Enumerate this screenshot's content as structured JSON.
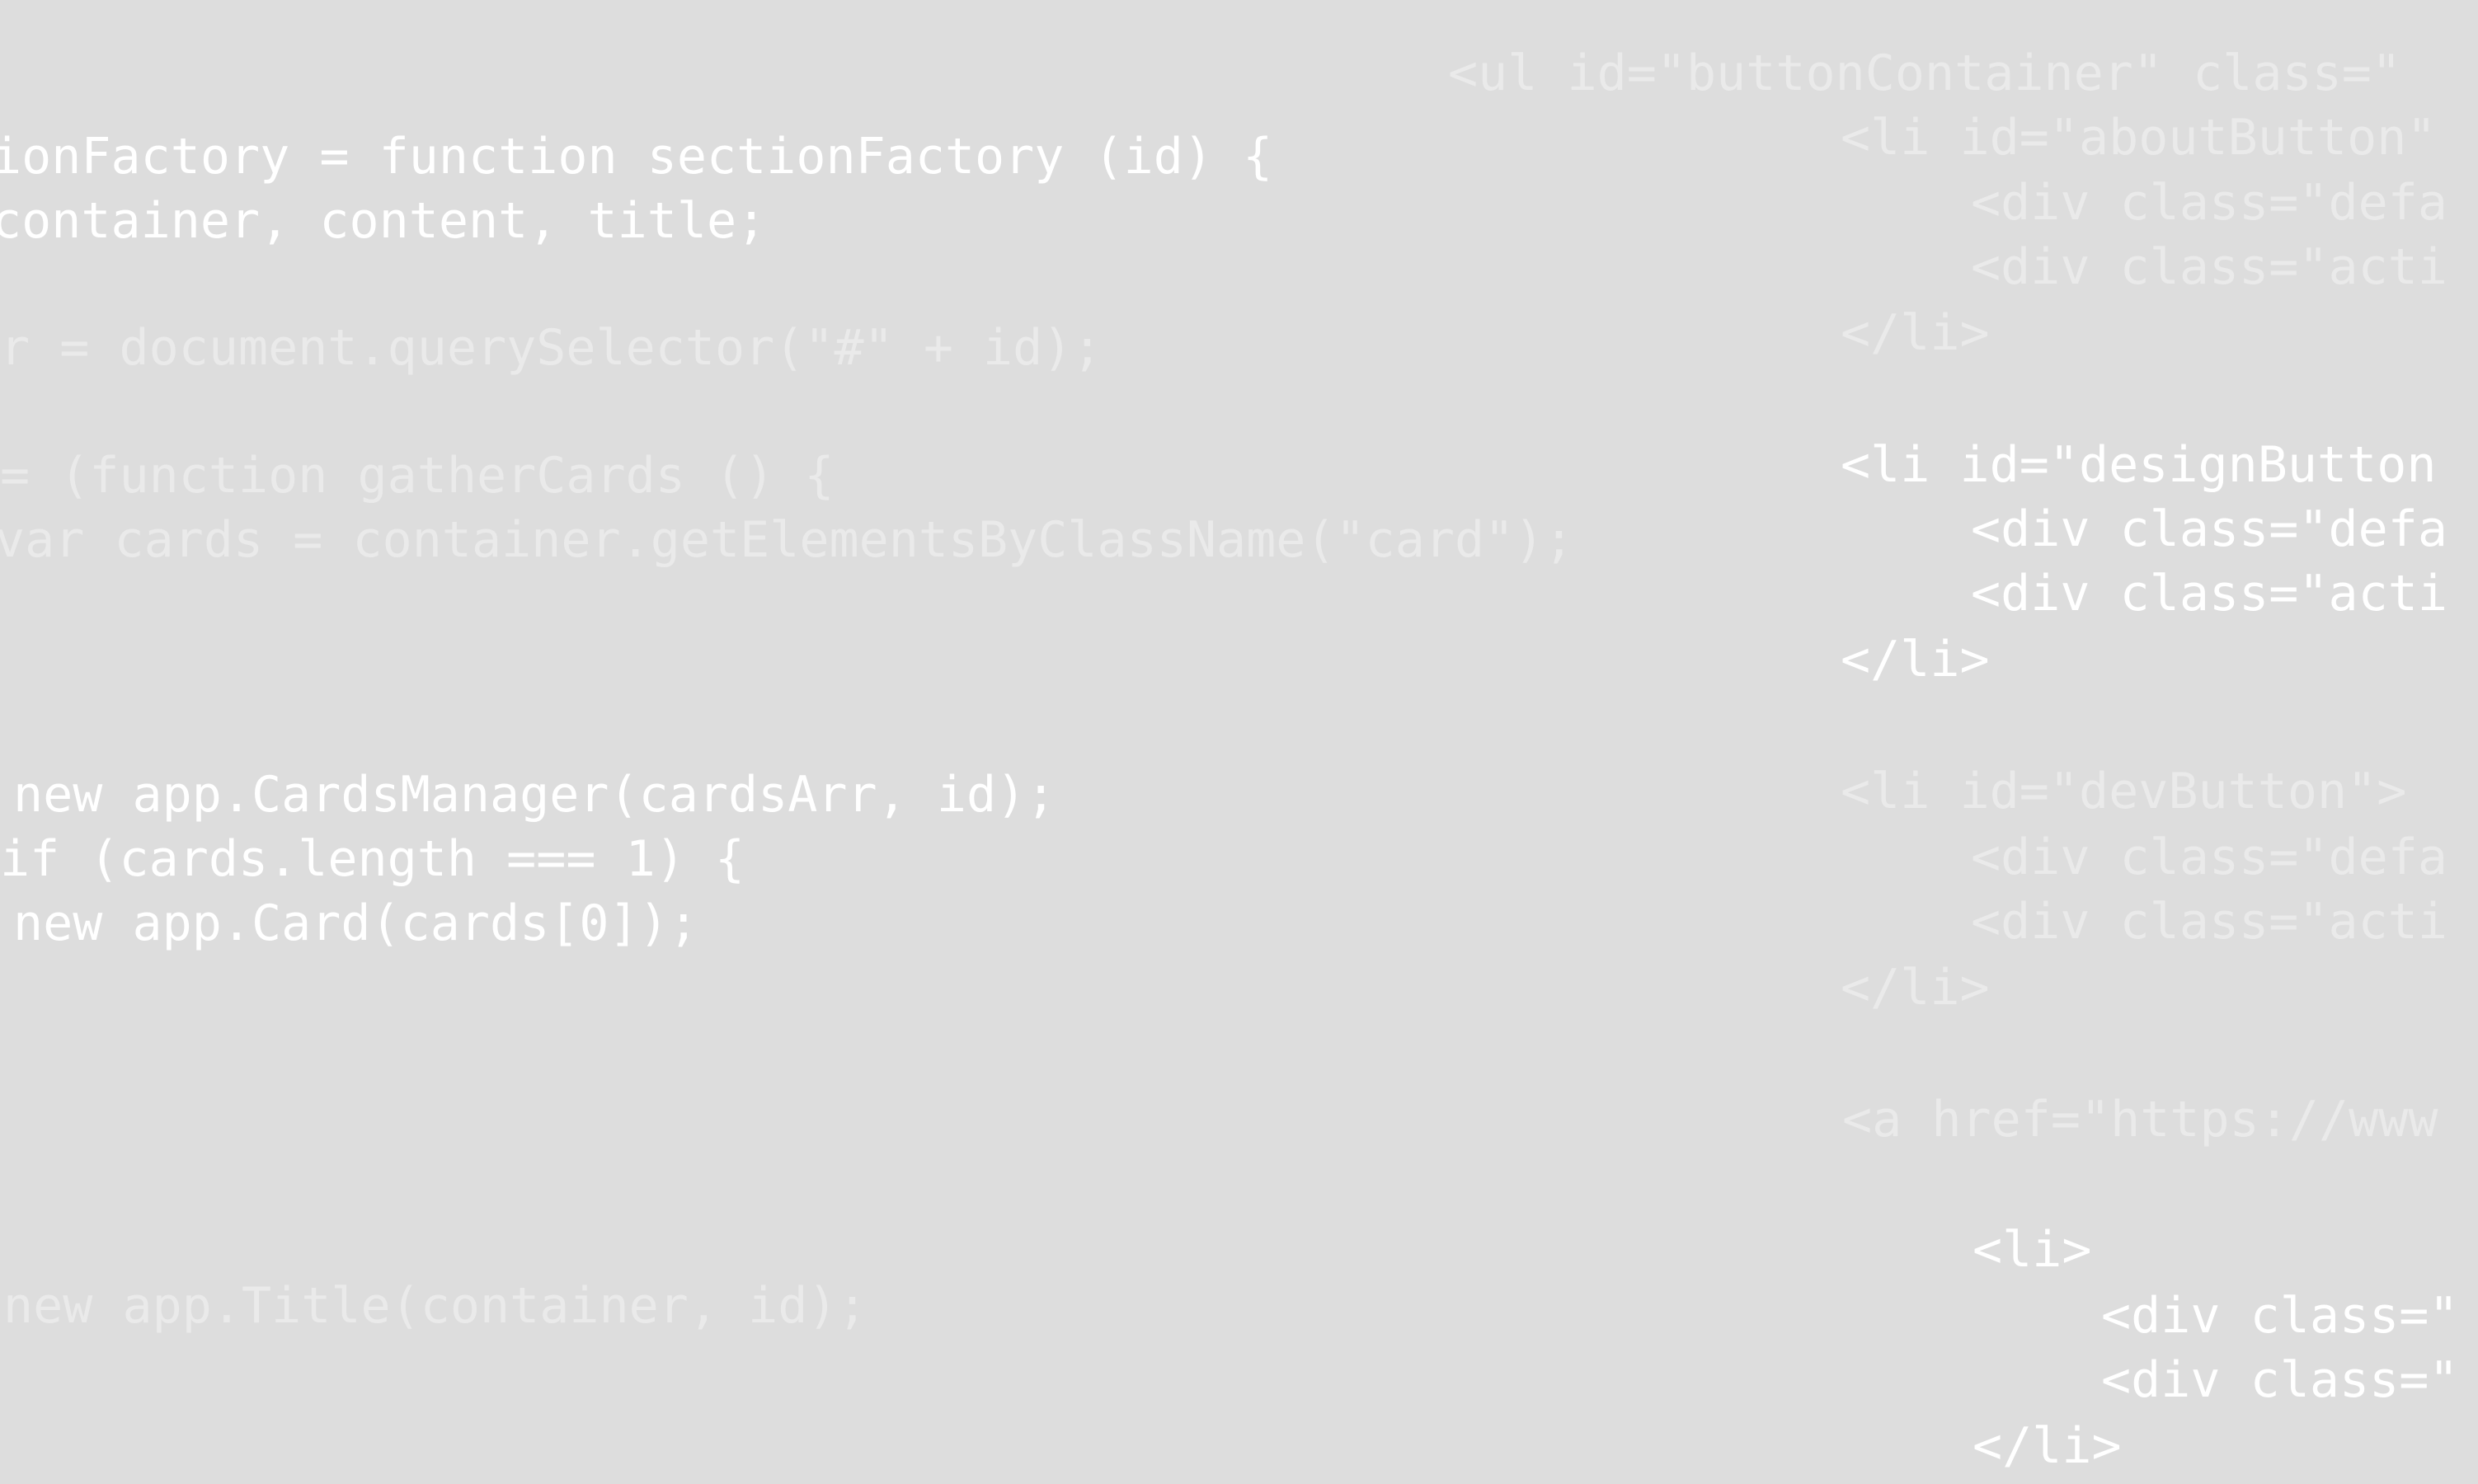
{
  "left_code": {
    "line_01": "ionFactory = function sectionFactory (id) {",
    "line_02": "container, content, title;",
    "line_03": "r = document.querySelector(\"#\" + id);",
    "line_04": "= (function gatherCards () {",
    "line_05": "var cards = container.getElementsByClassName(\"card\");",
    "line_06": "new app.CardsManager(cardsArr, id);",
    "line_07": "if (cards.length === 1) {",
    "line_08": "new app.Card(cards[0]);",
    "line_09": "new app.Title(container, id);"
  },
  "right_code": {
    "line_01": "<ul id=\"buttonContainer\" class=\"",
    "line_02": "<li id=\"aboutButton\"",
    "line_03": "<div class=\"defa",
    "line_04": "<div class=\"acti",
    "line_05": "</li>",
    "line_06": "<li id=\"designButton",
    "line_07": "<div class=\"defa",
    "line_08": "<div class=\"acti",
    "line_09": "</li>",
    "line_10": "<li id=\"devButton\">",
    "line_11": "<div class=\"defa",
    "line_12": "<div class=\"acti",
    "line_13": "</li>",
    "line_14": "<a href=\"https://www",
    "line_15": "<li>",
    "line_16": "<div class=\"",
    "line_17": "<div class=\"",
    "line_18": "</li>"
  },
  "colors": {
    "background": "#dddddd",
    "text_dim": "#eaeaea",
    "text_bright": "#ffffff"
  }
}
